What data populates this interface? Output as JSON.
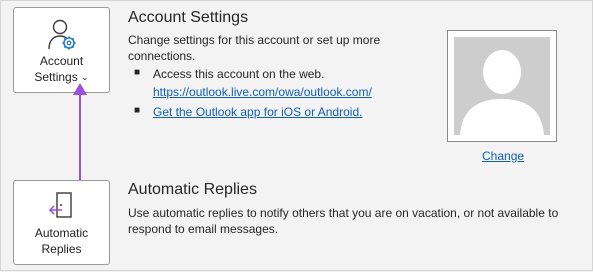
{
  "account_settings": {
    "tile_label_line1": "Account",
    "tile_label_line2": "Settings",
    "caret": "⌄",
    "title": "Account Settings",
    "description": "Change settings for this account or set up more connections.",
    "bullets": {
      "access_text": "Access this account on the web.",
      "url_link": "https://outlook.live.com/owa/outlook.com/",
      "app_link": "Get the Outlook app for iOS or Android."
    }
  },
  "profile": {
    "change_link": "Change"
  },
  "automatic_replies": {
    "tile_label_line1": "Automatic",
    "tile_label_line2": "Replies",
    "title": "Automatic Replies",
    "description": "Use automatic replies to notify others that you are on vacation, or not available to respond to email messages."
  },
  "icons": {
    "account_settings": "person-gear-icon",
    "automatic_replies": "door-arrow-icon",
    "profile_photo": "person-silhouette-icon",
    "annotation": "purple-arrow"
  },
  "colors": {
    "link": "#0f5fb4",
    "accent_icon": "#2b7cd3",
    "annotation_arrow": "#9b4fe0"
  }
}
